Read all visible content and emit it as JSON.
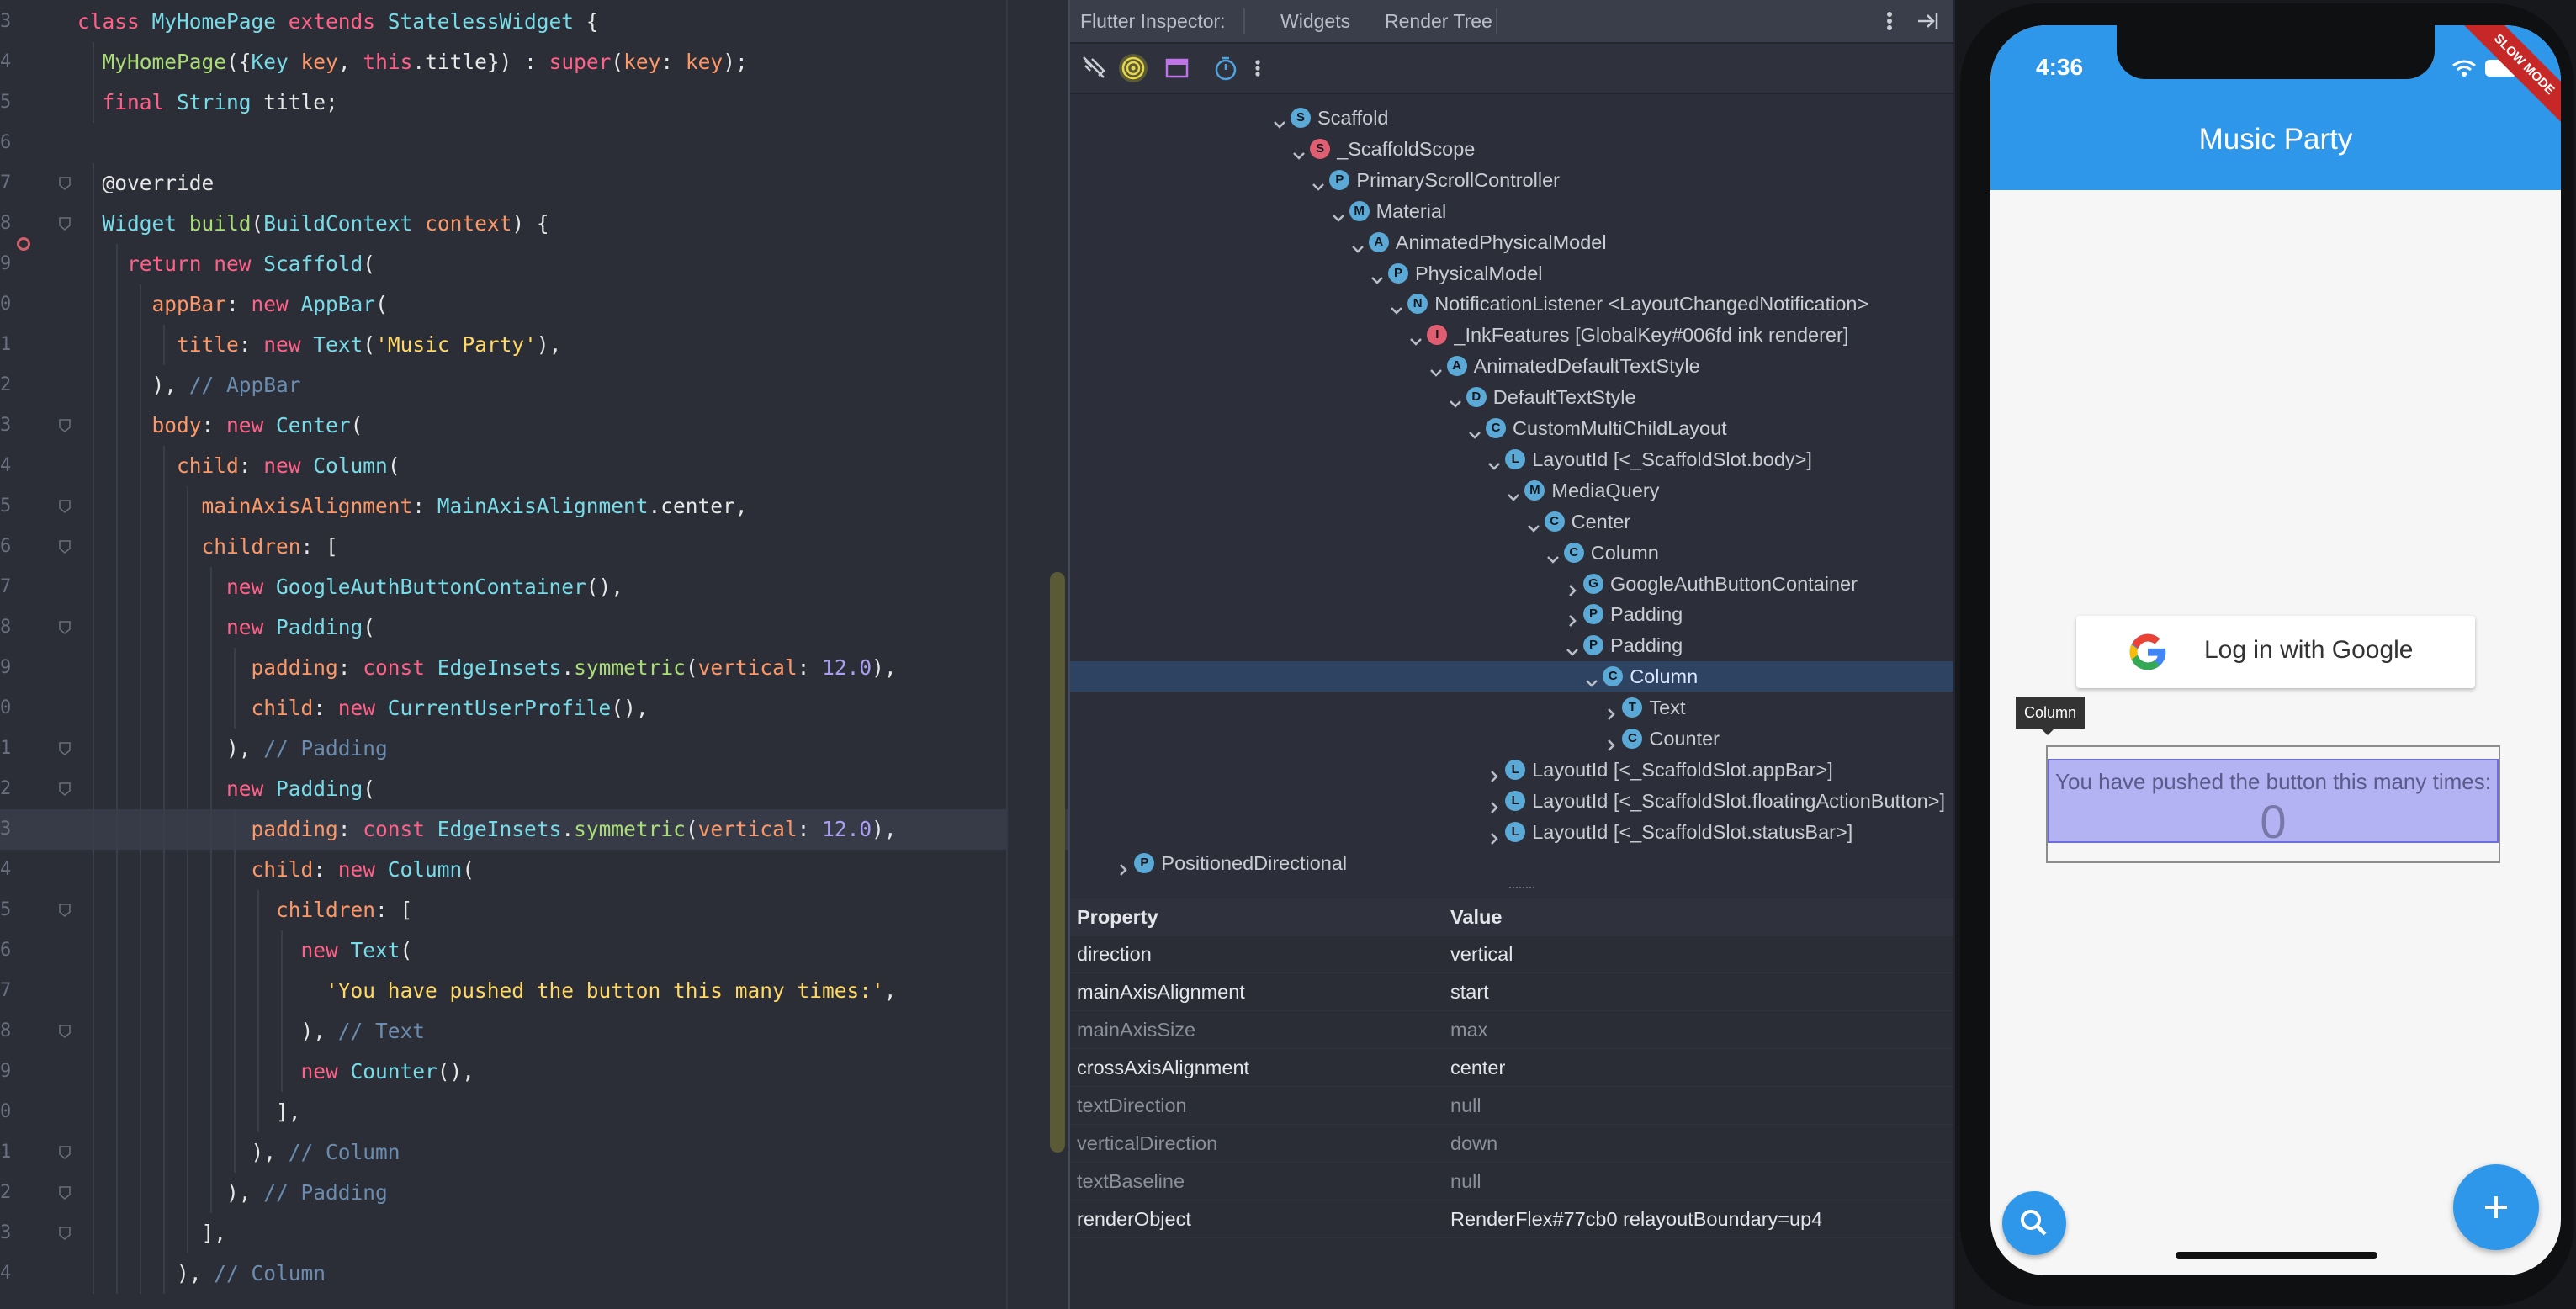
{
  "editor": {
    "line_numbers": [
      "3",
      "4",
      "5",
      "6",
      "7",
      "8",
      "9",
      "0",
      "1",
      "2",
      "3",
      "4",
      "5",
      "6",
      "7",
      "8",
      "9",
      "0",
      "1",
      "2",
      "3",
      "4",
      "5",
      "6",
      "7",
      "8",
      "9",
      "0",
      "1",
      "2",
      "3",
      "4"
    ],
    "lines": [
      [
        {
          "t": "class ",
          "c": "kw"
        },
        {
          "t": "MyHomePage ",
          "c": "cls"
        },
        {
          "t": "extends ",
          "c": "kw"
        },
        {
          "t": "StatelessWidget ",
          "c": "cls"
        },
        {
          "t": "{",
          "c": "pl"
        }
      ],
      [
        {
          "t": "  MyHomePage",
          "c": "fn"
        },
        {
          "t": "({",
          "c": "pl"
        },
        {
          "t": "Key ",
          "c": "cls"
        },
        {
          "t": "key",
          "c": "prm"
        },
        {
          "t": ", ",
          "c": "pl"
        },
        {
          "t": "this",
          "c": "kw"
        },
        {
          "t": ".title}) : ",
          "c": "pl"
        },
        {
          "t": "super",
          "c": "kw"
        },
        {
          "t": "(",
          "c": "pl"
        },
        {
          "t": "key",
          "c": "prm"
        },
        {
          "t": ": ",
          "c": "pl"
        },
        {
          "t": "key",
          "c": "prm"
        },
        {
          "t": ");",
          "c": "pl"
        }
      ],
      [
        {
          "t": "  final ",
          "c": "kw"
        },
        {
          "t": "String ",
          "c": "cls"
        },
        {
          "t": "title;",
          "c": "pl"
        }
      ],
      [],
      [
        {
          "t": "  @override",
          "c": "ann"
        }
      ],
      [
        {
          "t": "  Widget ",
          "c": "cls"
        },
        {
          "t": "build",
          "c": "fn"
        },
        {
          "t": "(",
          "c": "pl"
        },
        {
          "t": "BuildContext ",
          "c": "cls"
        },
        {
          "t": "context",
          "c": "prm"
        },
        {
          "t": ") {",
          "c": "pl"
        }
      ],
      [
        {
          "t": "    return new ",
          "c": "kw"
        },
        {
          "t": "Scaffold",
          "c": "cls"
        },
        {
          "t": "(",
          "c": "pl"
        }
      ],
      [
        {
          "t": "      appBar",
          "c": "prm"
        },
        {
          "t": ": ",
          "c": "pl"
        },
        {
          "t": "new ",
          "c": "kw"
        },
        {
          "t": "AppBar",
          "c": "cls"
        },
        {
          "t": "(",
          "c": "pl"
        }
      ],
      [
        {
          "t": "        title",
          "c": "prm"
        },
        {
          "t": ": ",
          "c": "pl"
        },
        {
          "t": "new ",
          "c": "kw"
        },
        {
          "t": "Text",
          "c": "cls"
        },
        {
          "t": "(",
          "c": "pl"
        },
        {
          "t": "'Music Party'",
          "c": "str"
        },
        {
          "t": "),",
          "c": "pl"
        }
      ],
      [
        {
          "t": "      ), ",
          "c": "pl"
        },
        {
          "t": "// AppBar",
          "c": "cm"
        }
      ],
      [
        {
          "t": "      body",
          "c": "prm"
        },
        {
          "t": ": ",
          "c": "pl"
        },
        {
          "t": "new ",
          "c": "kw"
        },
        {
          "t": "Center",
          "c": "cls"
        },
        {
          "t": "(",
          "c": "pl"
        }
      ],
      [
        {
          "t": "        child",
          "c": "prm"
        },
        {
          "t": ": ",
          "c": "pl"
        },
        {
          "t": "new ",
          "c": "kw"
        },
        {
          "t": "Column",
          "c": "cls"
        },
        {
          "t": "(",
          "c": "pl"
        }
      ],
      [
        {
          "t": "          mainAxisAlignment",
          "c": "prm"
        },
        {
          "t": ": ",
          "c": "pl"
        },
        {
          "t": "MainAxisAlignment",
          "c": "cls"
        },
        {
          "t": ".center,",
          "c": "pl"
        }
      ],
      [
        {
          "t": "          children",
          "c": "prm"
        },
        {
          "t": ": [",
          "c": "pl"
        }
      ],
      [
        {
          "t": "            new ",
          "c": "kw"
        },
        {
          "t": "GoogleAuthButtonContainer",
          "c": "cls"
        },
        {
          "t": "(),",
          "c": "pl"
        }
      ],
      [
        {
          "t": "            new ",
          "c": "kw"
        },
        {
          "t": "Padding",
          "c": "cls"
        },
        {
          "t": "(",
          "c": "pl"
        }
      ],
      [
        {
          "t": "              padding",
          "c": "prm"
        },
        {
          "t": ": ",
          "c": "pl"
        },
        {
          "t": "const ",
          "c": "kw"
        },
        {
          "t": "EdgeInsets",
          "c": "cls"
        },
        {
          "t": ".",
          "c": "pl"
        },
        {
          "t": "symmetric",
          "c": "fn"
        },
        {
          "t": "(",
          "c": "pl"
        },
        {
          "t": "vertical",
          "c": "prm"
        },
        {
          "t": ": ",
          "c": "pl"
        },
        {
          "t": "12.0",
          "c": "num"
        },
        {
          "t": "),",
          "c": "pl"
        }
      ],
      [
        {
          "t": "              child",
          "c": "prm"
        },
        {
          "t": ": ",
          "c": "pl"
        },
        {
          "t": "new ",
          "c": "kw"
        },
        {
          "t": "CurrentUserProfile",
          "c": "cls"
        },
        {
          "t": "(),",
          "c": "pl"
        }
      ],
      [
        {
          "t": "            ), ",
          "c": "pl"
        },
        {
          "t": "// Padding",
          "c": "cm"
        }
      ],
      [
        {
          "t": "            new ",
          "c": "kw"
        },
        {
          "t": "Padding",
          "c": "cls"
        },
        {
          "t": "(",
          "c": "pl"
        }
      ],
      [
        {
          "t": "              padding",
          "c": "prm"
        },
        {
          "t": ": ",
          "c": "pl"
        },
        {
          "t": "const ",
          "c": "kw"
        },
        {
          "t": "EdgeInsets",
          "c": "cls"
        },
        {
          "t": ".",
          "c": "pl"
        },
        {
          "t": "symmetric",
          "c": "fn"
        },
        {
          "t": "(",
          "c": "pl"
        },
        {
          "t": "vertical",
          "c": "prm"
        },
        {
          "t": ": ",
          "c": "pl"
        },
        {
          "t": "12.0",
          "c": "num"
        },
        {
          "t": "),",
          "c": "pl"
        }
      ],
      [
        {
          "t": "              child",
          "c": "prm"
        },
        {
          "t": ": ",
          "c": "pl"
        },
        {
          "t": "new ",
          "c": "kw"
        },
        {
          "t": "Column",
          "c": "cls"
        },
        {
          "t": "(",
          "c": "pl"
        }
      ],
      [
        {
          "t": "                children",
          "c": "prm"
        },
        {
          "t": ": [",
          "c": "pl"
        }
      ],
      [
        {
          "t": "                  new ",
          "c": "kw"
        },
        {
          "t": "Text",
          "c": "cls"
        },
        {
          "t": "(",
          "c": "pl"
        }
      ],
      [
        {
          "t": "                    'You have pushed the button this many times:'",
          "c": "str"
        },
        {
          "t": ",",
          "c": "pl"
        }
      ],
      [
        {
          "t": "                  ), ",
          "c": "pl"
        },
        {
          "t": "// Text",
          "c": "cm"
        }
      ],
      [
        {
          "t": "                  new ",
          "c": "kw"
        },
        {
          "t": "Counter",
          "c": "cls"
        },
        {
          "t": "(),",
          "c": "pl"
        }
      ],
      [
        {
          "t": "                ],",
          "c": "pl"
        }
      ],
      [
        {
          "t": "              ), ",
          "c": "pl"
        },
        {
          "t": "// Column",
          "c": "cm"
        }
      ],
      [
        {
          "t": "            ), ",
          "c": "pl"
        },
        {
          "t": "// Padding",
          "c": "cm"
        }
      ],
      [
        {
          "t": "          ],",
          "c": "pl"
        }
      ],
      [
        {
          "t": "        ), ",
          "c": "pl"
        },
        {
          "t": "// Column",
          "c": "cm"
        }
      ]
    ],
    "active_line": 20,
    "fold_lines": [
      4,
      5,
      10,
      12,
      13,
      15,
      18,
      19,
      22,
      25,
      28,
      29,
      30
    ],
    "colors": {
      "keyword": "#ff6188",
      "class": "#78dce8",
      "function": "#a9dc76",
      "string": "#ffd866",
      "number": "#ab9df2",
      "comment": "#6b8cae",
      "param": "#fc9867"
    }
  },
  "inspector": {
    "tabs": [
      "Flutter Inspector:",
      "Widgets",
      "Render Tree"
    ],
    "toolbar_icons": [
      "toggle-select-mode-icon",
      "debug-paint-icon",
      "performance-overlay-icon",
      "slow-animations-icon",
      "more-vert-icon"
    ],
    "window_icons": [
      "more-options-icon",
      "hide-panel-icon"
    ],
    "tree": [
      {
        "label": "Scaffold",
        "badge": "S",
        "color": "#5aa9d6",
        "depth": 10,
        "state": "open"
      },
      {
        "label": "_ScaffoldScope",
        "badge": "S",
        "color": "#e05e72",
        "depth": 11,
        "state": "open"
      },
      {
        "label": "PrimaryScrollController",
        "badge": "P",
        "color": "#5aa9d6",
        "depth": 12,
        "state": "open"
      },
      {
        "label": "Material",
        "badge": "M",
        "color": "#5aa9d6",
        "depth": 13,
        "state": "open"
      },
      {
        "label": "AnimatedPhysicalModel",
        "badge": "A",
        "color": "#5aa9d6",
        "depth": 14,
        "state": "open"
      },
      {
        "label": "PhysicalModel",
        "badge": "P",
        "color": "#5aa9d6",
        "depth": 15,
        "state": "open"
      },
      {
        "label": "NotificationListener <LayoutChangedNotification>",
        "badge": "N",
        "color": "#5aa9d6",
        "depth": 16,
        "state": "open"
      },
      {
        "label": "_InkFeatures [GlobalKey#006fd ink renderer]",
        "badge": "I",
        "color": "#e05e72",
        "depth": 17,
        "state": "open"
      },
      {
        "label": "AnimatedDefaultTextStyle",
        "badge": "A",
        "color": "#5aa9d6",
        "depth": 18,
        "state": "open"
      },
      {
        "label": "DefaultTextStyle",
        "badge": "D",
        "color": "#5aa9d6",
        "depth": 19,
        "state": "open"
      },
      {
        "label": "CustomMultiChildLayout",
        "badge": "C",
        "color": "#5aa9d6",
        "depth": 20,
        "state": "open"
      },
      {
        "label": "LayoutId [<_ScaffoldSlot.body>]",
        "badge": "L",
        "color": "#5aa9d6",
        "depth": 21,
        "state": "open"
      },
      {
        "label": "MediaQuery",
        "badge": "M",
        "color": "#5aa9d6",
        "depth": 22,
        "state": "open"
      },
      {
        "label": "Center",
        "badge": "C",
        "color": "#5aa9d6",
        "depth": 23,
        "state": "open"
      },
      {
        "label": "Column",
        "badge": "C",
        "color": "#5aa9d6",
        "depth": 24,
        "state": "open"
      },
      {
        "label": "GoogleAuthButtonContainer",
        "badge": "G",
        "color": "#5aa9d6",
        "depth": 25,
        "state": "closed"
      },
      {
        "label": "Padding",
        "badge": "P",
        "color": "#5aa9d6",
        "depth": 25,
        "state": "closed"
      },
      {
        "label": "Padding",
        "badge": "P",
        "color": "#5aa9d6",
        "depth": 25,
        "state": "open"
      },
      {
        "label": "Column",
        "badge": "C",
        "color": "#5aa9d6",
        "depth": 26,
        "state": "open",
        "selected": true
      },
      {
        "label": "Text",
        "badge": "T",
        "color": "#5aa9d6",
        "depth": 27,
        "state": "closed"
      },
      {
        "label": "Counter",
        "badge": "C",
        "color": "#5aa9d6",
        "depth": 27,
        "state": "closed"
      },
      {
        "label": "LayoutId [<_ScaffoldSlot.appBar>]",
        "badge": "L",
        "color": "#5aa9d6",
        "depth": 21,
        "state": "closed"
      },
      {
        "label": "LayoutId [<_ScaffoldSlot.floatingActionButton>]",
        "badge": "L",
        "color": "#5aa9d6",
        "depth": 21,
        "state": "closed"
      },
      {
        "label": "LayoutId [<_ScaffoldSlot.statusBar>]",
        "badge": "L",
        "color": "#5aa9d6",
        "depth": 21,
        "state": "closed"
      },
      {
        "label": "PositionedDirectional",
        "badge": "P",
        "color": "#5aa9d6",
        "depth": 2,
        "state": "closed"
      }
    ],
    "properties": {
      "header": {
        "name": "Property",
        "value": "Value"
      },
      "rows": [
        {
          "name": "direction",
          "value": "vertical",
          "dim": false
        },
        {
          "name": "mainAxisAlignment",
          "value": "start",
          "dim": false
        },
        {
          "name": "mainAxisSize",
          "value": "max",
          "dim": true
        },
        {
          "name": "crossAxisAlignment",
          "value": "center",
          "dim": false
        },
        {
          "name": "textDirection",
          "value": "null",
          "dim": true
        },
        {
          "name": "verticalDirection",
          "value": "down",
          "dim": true
        },
        {
          "name": "textBaseline",
          "value": "null",
          "dim": true
        },
        {
          "name": "renderObject",
          "value": "RenderFlex#77cb0 relayoutBoundary=up4",
          "dim": false
        }
      ]
    }
  },
  "phone": {
    "status_time": "4:36",
    "debug_banner": "SLOW MODE",
    "app_title": "Music Party",
    "google_button_label": "Log in with Google",
    "column_tooltip": "Column",
    "pushed_text": "You have pushed the button this many times:",
    "counter_value": "0",
    "colors": {
      "primary": "#2f97ea",
      "background": "#f6f6f6",
      "highlight": "#b3b3f4"
    }
  }
}
